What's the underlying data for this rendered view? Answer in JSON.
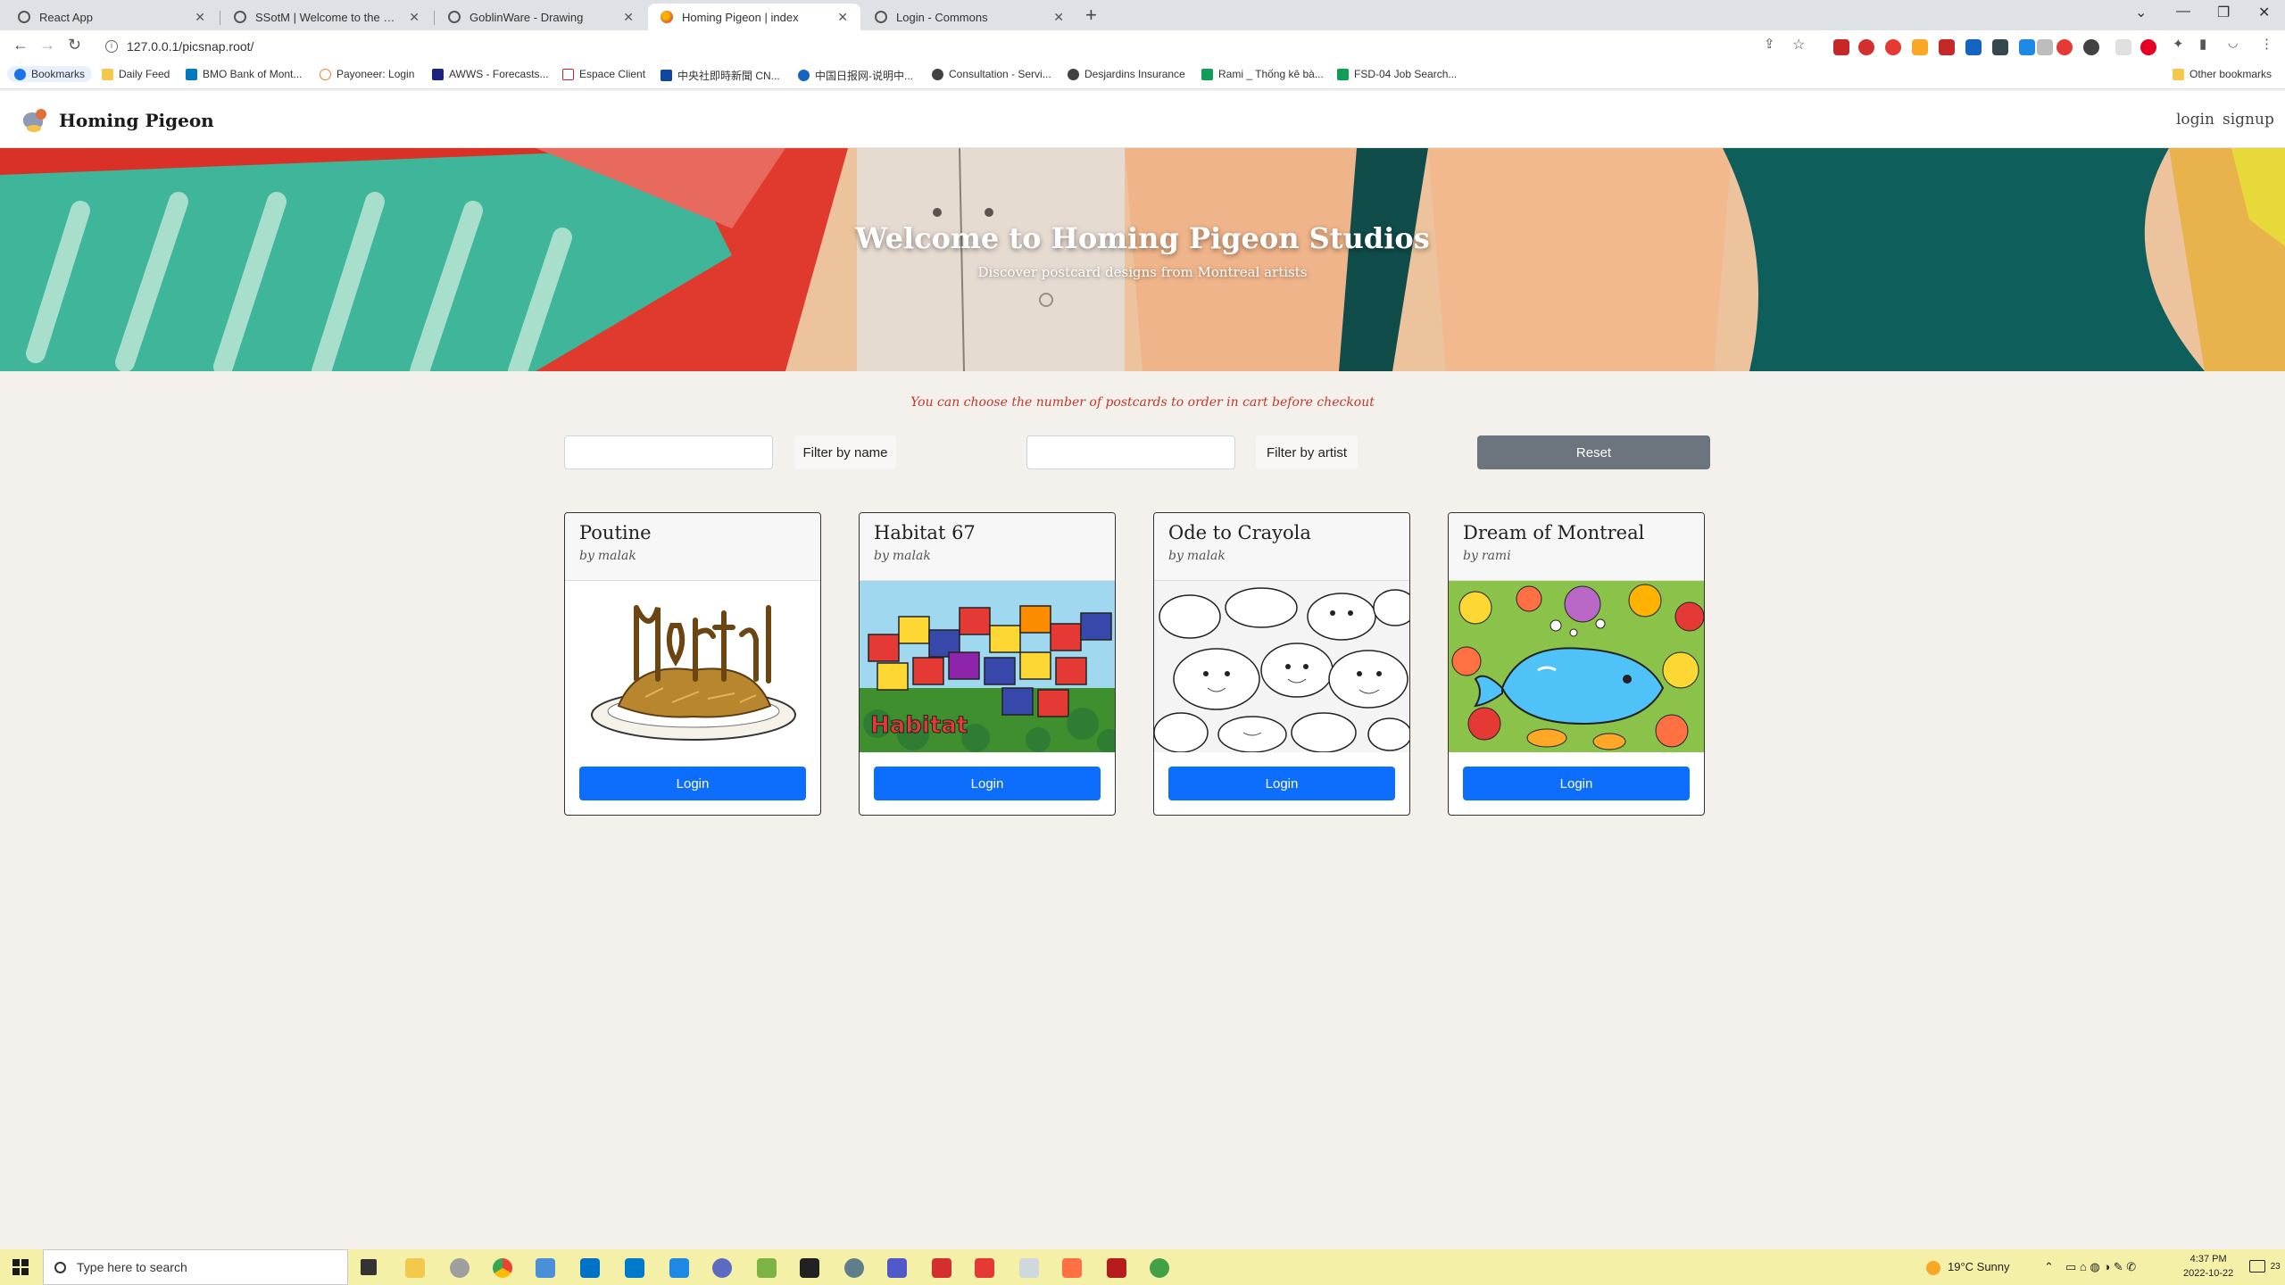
{
  "browser": {
    "tabs": [
      {
        "label": "React App",
        "active": false
      },
      {
        "label": "SSotM | Welcome to the Sunny S",
        "active": false
      },
      {
        "label": "GoblinWare - Drawing",
        "active": false
      },
      {
        "label": "Homing Pigeon | index",
        "active": true
      },
      {
        "label": "Login - Commons",
        "active": false
      }
    ],
    "new_tab": "+",
    "url": "127.0.0.1/picsnap.root/",
    "bookmarks": [
      {
        "label": "Bookmarks"
      },
      {
        "label": "Daily Feed"
      },
      {
        "label": "BMO Bank of Mont..."
      },
      {
        "label": "Payoneer: Login"
      },
      {
        "label": "AWWS - Forecasts..."
      },
      {
        "label": "Espace Client"
      },
      {
        "label": "中央社即時新聞 CN..."
      },
      {
        "label": "中国日报网-说明中..."
      },
      {
        "label": "Consultation - Servi..."
      },
      {
        "label": "Desjardins Insurance"
      },
      {
        "label": "Rami _ Thống kê bà..."
      },
      {
        "label": "FSD-04 Job Search..."
      }
    ],
    "other_bookmarks": "Other bookmarks"
  },
  "site": {
    "brand": "Homing Pigeon",
    "nav": {
      "login": "login",
      "signup": "signup"
    },
    "hero": {
      "title": "Welcome to Homing Pigeon Studios",
      "subtitle": "Discover postcard designs from Montreal artists"
    },
    "notice": "You can choose the number of postcards to order in cart before checkout",
    "filters": {
      "name_value": "",
      "name_button": "Filter by name",
      "artist_value": "",
      "artist_button": "Filter by artist",
      "reset_button": "Reset"
    },
    "by_label": "by",
    "cards": [
      {
        "title": "Poutine",
        "artist": "malak",
        "image": "poutine-montreal-drawing",
        "button": "Login"
      },
      {
        "title": "Habitat 67",
        "artist": "malak",
        "image": "habitat-67-drawing",
        "button": "Login"
      },
      {
        "title": "Ode to Crayola",
        "artist": "malak",
        "image": "black-white-doodle",
        "button": "Login"
      },
      {
        "title": "Dream of Montreal",
        "artist": "rami",
        "image": "colorful-whale-doodle",
        "button": "Login"
      }
    ]
  },
  "taskbar": {
    "search_placeholder": "Type here to search",
    "weather": "19°C  Sunny",
    "time": "4:37 PM",
    "date": "2022-10-22",
    "notification_count": "23"
  }
}
